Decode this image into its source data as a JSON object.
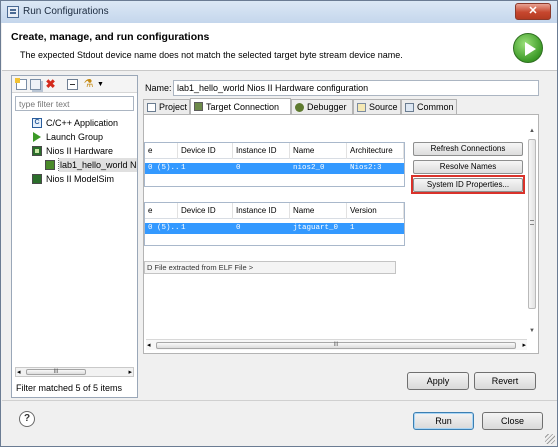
{
  "window": {
    "title": "Run Configurations",
    "close_symbol": "✕"
  },
  "header": {
    "title": "Create, manage, and run configurations",
    "message": "The expected Stdout device name does not match the selected target byte stream device name."
  },
  "left_panel": {
    "filter_placeholder": "type filter text",
    "tree": [
      {
        "label": "C/C++ Application"
      },
      {
        "label": "Launch Group"
      },
      {
        "label": "Nios II Hardware"
      },
      {
        "label": "lab1_hello_world N"
      },
      {
        "label": "Nios II ModelSim"
      }
    ],
    "scroll_grip": "III",
    "status": "Filter matched 5 of 5 items"
  },
  "config": {
    "name_label": "Name:",
    "name_value": "lab1_hello_world Nios II Hardware configuration",
    "tabs": [
      "Project",
      "Target Connection",
      "Debugger",
      "Source",
      "Common"
    ]
  },
  "processors_table": {
    "headers": [
      "e",
      "Device ID",
      "Instance ID",
      "Name",
      "Architecture"
    ],
    "row": [
      "0 (5)...",
      "1",
      "0",
      "nios2_0",
      "Nios2:3"
    ]
  },
  "byte_stream_table": {
    "headers": [
      "e",
      "Device ID",
      "Instance ID",
      "Name",
      "Version"
    ],
    "row": [
      "0 (5)...",
      "1",
      "0",
      "jtaguart_0",
      "1"
    ]
  },
  "buttons": {
    "refresh": "Refresh Connections",
    "resolve": "Resolve Names",
    "sysid": "System ID Properties...",
    "apply": "Apply",
    "revert": "Revert",
    "run": "Run",
    "close": "Close"
  },
  "elf_field": "D File extracted from ELF File >",
  "help": "?"
}
